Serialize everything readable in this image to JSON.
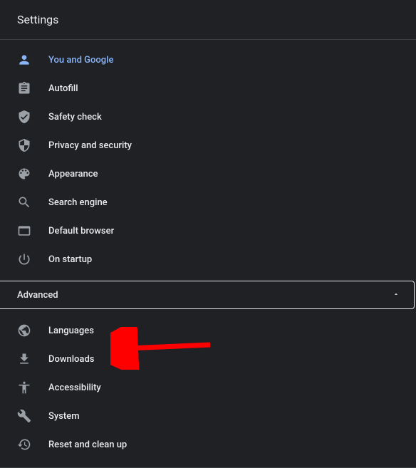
{
  "header": {
    "title": "Settings"
  },
  "nav": {
    "main": [
      {
        "id": "you-and-google",
        "label": "You and Google",
        "icon": "person-icon",
        "active": true
      },
      {
        "id": "autofill",
        "label": "Autofill",
        "icon": "clipboard-icon",
        "active": false
      },
      {
        "id": "safety-check",
        "label": "Safety check",
        "icon": "shield-check-icon",
        "active": false
      },
      {
        "id": "privacy-security",
        "label": "Privacy and security",
        "icon": "shield-icon",
        "active": false
      },
      {
        "id": "appearance",
        "label": "Appearance",
        "icon": "palette-icon",
        "active": false
      },
      {
        "id": "search-engine",
        "label": "Search engine",
        "icon": "search-icon",
        "active": false
      },
      {
        "id": "default-browser",
        "label": "Default browser",
        "icon": "browser-icon",
        "active": false
      },
      {
        "id": "on-startup",
        "label": "On startup",
        "icon": "power-icon",
        "active": false
      }
    ],
    "advanced": {
      "label": "Advanced",
      "expanded": true,
      "items": [
        {
          "id": "languages",
          "label": "Languages",
          "icon": "globe-icon"
        },
        {
          "id": "downloads",
          "label": "Downloads",
          "icon": "download-icon"
        },
        {
          "id": "accessibility",
          "label": "Accessibility",
          "icon": "accessibility-icon"
        },
        {
          "id": "system",
          "label": "System",
          "icon": "wrench-icon"
        },
        {
          "id": "reset",
          "label": "Reset and clean up",
          "icon": "restore-icon"
        }
      ]
    }
  },
  "annotation": {
    "arrow_color": "#ff0000",
    "points_to": "downloads"
  }
}
